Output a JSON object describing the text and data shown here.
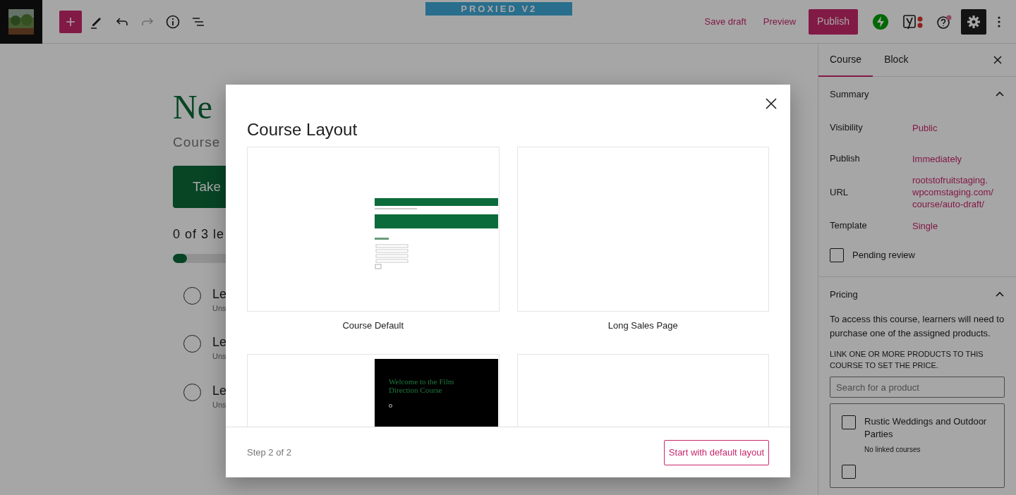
{
  "banner": "PROXIED V2",
  "toolbar": {
    "undo_disabled": false,
    "redo_disabled": true,
    "actions": [
      "Save draft",
      "Preview"
    ],
    "publish": "Publish"
  },
  "editor": {
    "title": "Ne",
    "subtitle": "Course",
    "button": "Take",
    "progress_text": "0 of 3 le",
    "progress": {
      "level": 0.06
    },
    "lessons": [
      {
        "title": "Le",
        "status": "Uns",
        "checked": false
      },
      {
        "title": "Le",
        "status": "Uns",
        "checked": false
      },
      {
        "title": "Le",
        "status": "Uns",
        "checked": false
      }
    ]
  },
  "modal": {
    "title": "Course Layout",
    "step": "Step 2 of 2",
    "button": "Start with default layout",
    "layouts": [
      {
        "kind": "course",
        "label": "Course Default"
      },
      {
        "kind": "blank",
        "label": "Long Sales Page"
      },
      {
        "kind": "dark",
        "heading": "Welcome to the Film Direction Course"
      },
      {
        "kind": "blank"
      }
    ]
  },
  "sidebar": {
    "tabs": [
      {
        "label": "Course",
        "selected": true
      },
      {
        "label": "Block",
        "selected": false
      }
    ],
    "summary": {
      "title": "Summary",
      "expanded": true,
      "rows": [
        {
          "label": "Visibility",
          "value": "Public"
        },
        {
          "label": "Publish",
          "value": "Immediately"
        },
        {
          "label": "URL",
          "value": "rootstofruitstaging.\nwpcomstaging.com/\ncourse/auto-draft/"
        },
        {
          "label": "Template",
          "value": "Single"
        }
      ],
      "pending": {
        "label": "Pending review",
        "checked": false
      }
    },
    "pricing": {
      "title": "Pricing",
      "expanded": true,
      "description": "To access this course, learners will need to purchase one of the assigned products.",
      "hint": "LINK ONE OR MORE PRODUCTS TO THIS COURSE TO SET THE PRICE.",
      "search": {
        "placeholder": "Search for a product"
      },
      "products": [
        {
          "name": "Rustic Weddings and Outdoor Parties",
          "note": "No linked courses",
          "checked": false
        },
        {
          "checked": false
        }
      ]
    }
  }
}
